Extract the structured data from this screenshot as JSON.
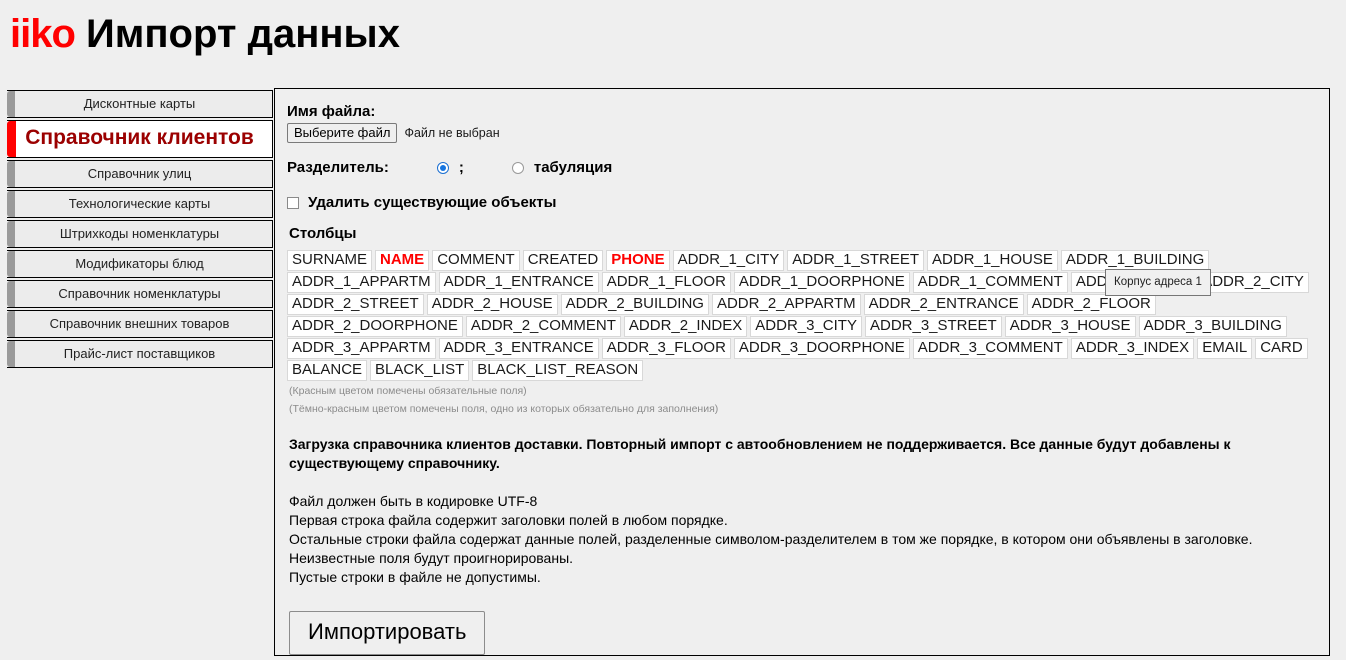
{
  "header": {
    "brand": "iiko",
    "title": "Импорт данных"
  },
  "sidebar": {
    "items": [
      {
        "label": "Дисконтные карты",
        "active": false
      },
      {
        "label": "Справочник клиентов",
        "active": true
      },
      {
        "label": "Справочник улиц",
        "active": false
      },
      {
        "label": "Технологические карты",
        "active": false
      },
      {
        "label": "Штрихкоды номенклатуры",
        "active": false
      },
      {
        "label": "Модификаторы блюд",
        "active": false
      },
      {
        "label": "Справочник номенклатуры",
        "active": false
      },
      {
        "label": "Справочник внешних товаров",
        "active": false
      },
      {
        "label": "Прайс-лист поставщиков",
        "active": false
      }
    ]
  },
  "main": {
    "file_label": "Имя файла:",
    "file_button": "Выберите файл",
    "file_status": "Файл не выбран",
    "separator_label": "Разделитель:",
    "separator_options": [
      {
        "label": ";",
        "checked": true
      },
      {
        "label": "табуляция",
        "checked": false
      }
    ],
    "delete_existing_label": "Удалить существующие объекты",
    "delete_existing_checked": false,
    "columns_title": "Столбцы",
    "columns": [
      {
        "name": "SURNAME",
        "style": "normal"
      },
      {
        "name": "NAME",
        "style": "required"
      },
      {
        "name": "COMMENT",
        "style": "normal"
      },
      {
        "name": "CREATED",
        "style": "normal"
      },
      {
        "name": "PHONE",
        "style": "required"
      },
      {
        "name": "ADDR_1_CITY",
        "style": "normal"
      },
      {
        "name": "ADDR_1_STREET",
        "style": "normal"
      },
      {
        "name": "ADDR_1_HOUSE",
        "style": "normal"
      },
      {
        "name": "ADDR_1_BUILDING",
        "style": "normal"
      },
      {
        "name": "ADDR_1_APPARTM",
        "style": "normal"
      },
      {
        "name": "ADDR_1_ENTRANCE",
        "style": "normal"
      },
      {
        "name": "ADDR_1_FLOOR",
        "style": "normal"
      },
      {
        "name": "ADDR_1_DOORPHONE",
        "style": "normal"
      },
      {
        "name": "ADDR_1_COMMENT",
        "style": "normal"
      },
      {
        "name": "ADDR_1_INDEX",
        "style": "normal"
      },
      {
        "name": "ADDR_2_CITY",
        "style": "normal"
      },
      {
        "name": "ADDR_2_STREET",
        "style": "normal"
      },
      {
        "name": "ADDR_2_HOUSE",
        "style": "normal"
      },
      {
        "name": "ADDR_2_BUILDING",
        "style": "normal"
      },
      {
        "name": "ADDR_2_APPARTM",
        "style": "normal"
      },
      {
        "name": "ADDR_2_ENTRANCE",
        "style": "normal"
      },
      {
        "name": "ADDR_2_FLOOR",
        "style": "normal"
      },
      {
        "name": "ADDR_2_DOORPHONE",
        "style": "normal"
      },
      {
        "name": "ADDR_2_COMMENT",
        "style": "normal"
      },
      {
        "name": "ADDR_2_INDEX",
        "style": "normal"
      },
      {
        "name": "ADDR_3_CITY",
        "style": "normal"
      },
      {
        "name": "ADDR_3_STREET",
        "style": "normal"
      },
      {
        "name": "ADDR_3_HOUSE",
        "style": "normal"
      },
      {
        "name": "ADDR_3_BUILDING",
        "style": "normal"
      },
      {
        "name": "ADDR_3_APPARTM",
        "style": "normal"
      },
      {
        "name": "ADDR_3_ENTRANCE",
        "style": "normal"
      },
      {
        "name": "ADDR_3_FLOOR",
        "style": "normal"
      },
      {
        "name": "ADDR_3_DOORPHONE",
        "style": "normal"
      },
      {
        "name": "ADDR_3_COMMENT",
        "style": "normal"
      },
      {
        "name": "ADDR_3_INDEX",
        "style": "normal"
      },
      {
        "name": "EMAIL",
        "style": "normal"
      },
      {
        "name": "CARD",
        "style": "normal"
      },
      {
        "name": "BALANCE",
        "style": "normal"
      },
      {
        "name": "BLACK_LIST",
        "style": "normal"
      },
      {
        "name": "BLACK_LIST_REASON",
        "style": "normal"
      }
    ],
    "tooltip": "Корпус адреса 1",
    "note_required": "(Красным цветом помечены обязательные поля)",
    "note_required_one": "(Тёмно-красным цветом помечены поля, одно из которых обязательно для заполнения)",
    "description": "Загрузка справочника клиентов доставки. Повторный импорт с автообновлением не поддерживается. Все данные будут добавлены к существующему справочнику.",
    "instructions": [
      "Файл должен быть в кодировке UTF-8",
      "Первая строка файла содержит заголовки полей в любом порядке.",
      "Остальные строки файла содержат данные полей, разделенные символом-разделителем в том же порядке, в котором они объявлены в заголовке.",
      "Неизвестные поля будут проигнорированы.",
      "Пустые строки в файле не допустимы."
    ],
    "import_button": "Импортировать"
  },
  "colors": {
    "brand_red": "#ff0000",
    "active_item_red": "#9b0000",
    "required_red": "#ff0000",
    "page_bg": "#efefef"
  }
}
